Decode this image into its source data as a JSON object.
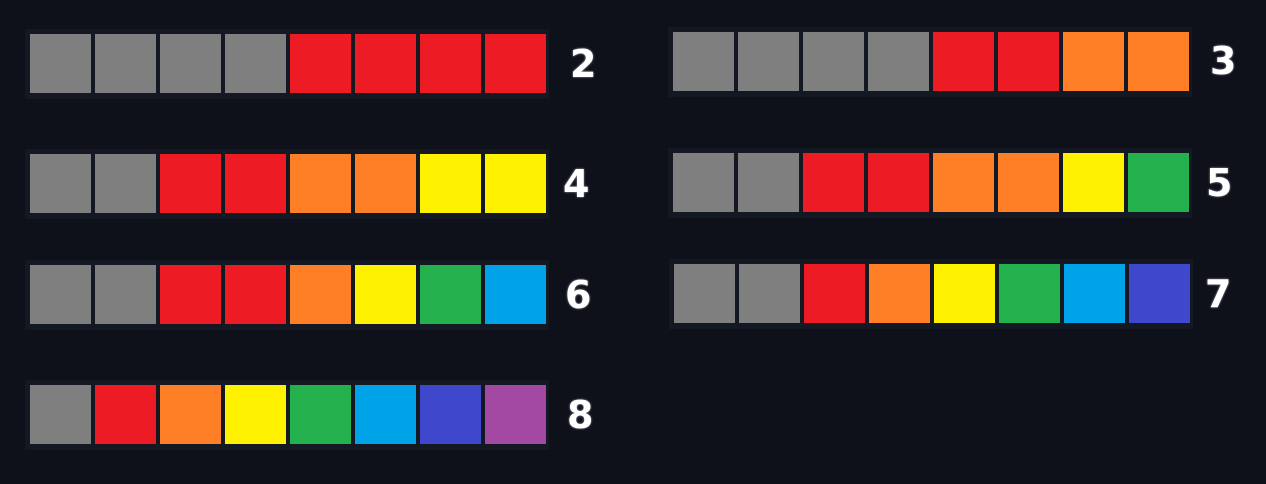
{
  "colors": {
    "gray": "#7f7f7f",
    "red": "#ed1c24",
    "orange": "#ff7f27",
    "yellow": "#fff200",
    "green": "#22b14c",
    "blue": "#00a2e8",
    "indigo": "#3f48cc",
    "purple": "#a349a4",
    "background": "#0e111a",
    "strip_background": "#141823"
  },
  "palettes": [
    {
      "label": "2",
      "swatches": [
        "gray",
        "gray",
        "gray",
        "gray",
        "red",
        "red",
        "red",
        "red"
      ]
    },
    {
      "label": "3",
      "swatches": [
        "gray",
        "gray",
        "gray",
        "gray",
        "red",
        "red",
        "orange",
        "orange"
      ]
    },
    {
      "label": "4",
      "swatches": [
        "gray",
        "gray",
        "red",
        "red",
        "orange",
        "orange",
        "yellow",
        "yellow"
      ]
    },
    {
      "label": "5",
      "swatches": [
        "gray",
        "gray",
        "red",
        "red",
        "orange",
        "orange",
        "yellow",
        "green"
      ]
    },
    {
      "label": "6",
      "swatches": [
        "gray",
        "gray",
        "red",
        "red",
        "orange",
        "yellow",
        "green",
        "blue"
      ]
    },
    {
      "label": "7",
      "swatches": [
        "gray",
        "gray",
        "red",
        "orange",
        "yellow",
        "green",
        "blue",
        "indigo"
      ]
    },
    {
      "label": "8",
      "swatches": [
        "gray",
        "red",
        "orange",
        "yellow",
        "green",
        "blue",
        "indigo",
        "purple"
      ]
    }
  ]
}
